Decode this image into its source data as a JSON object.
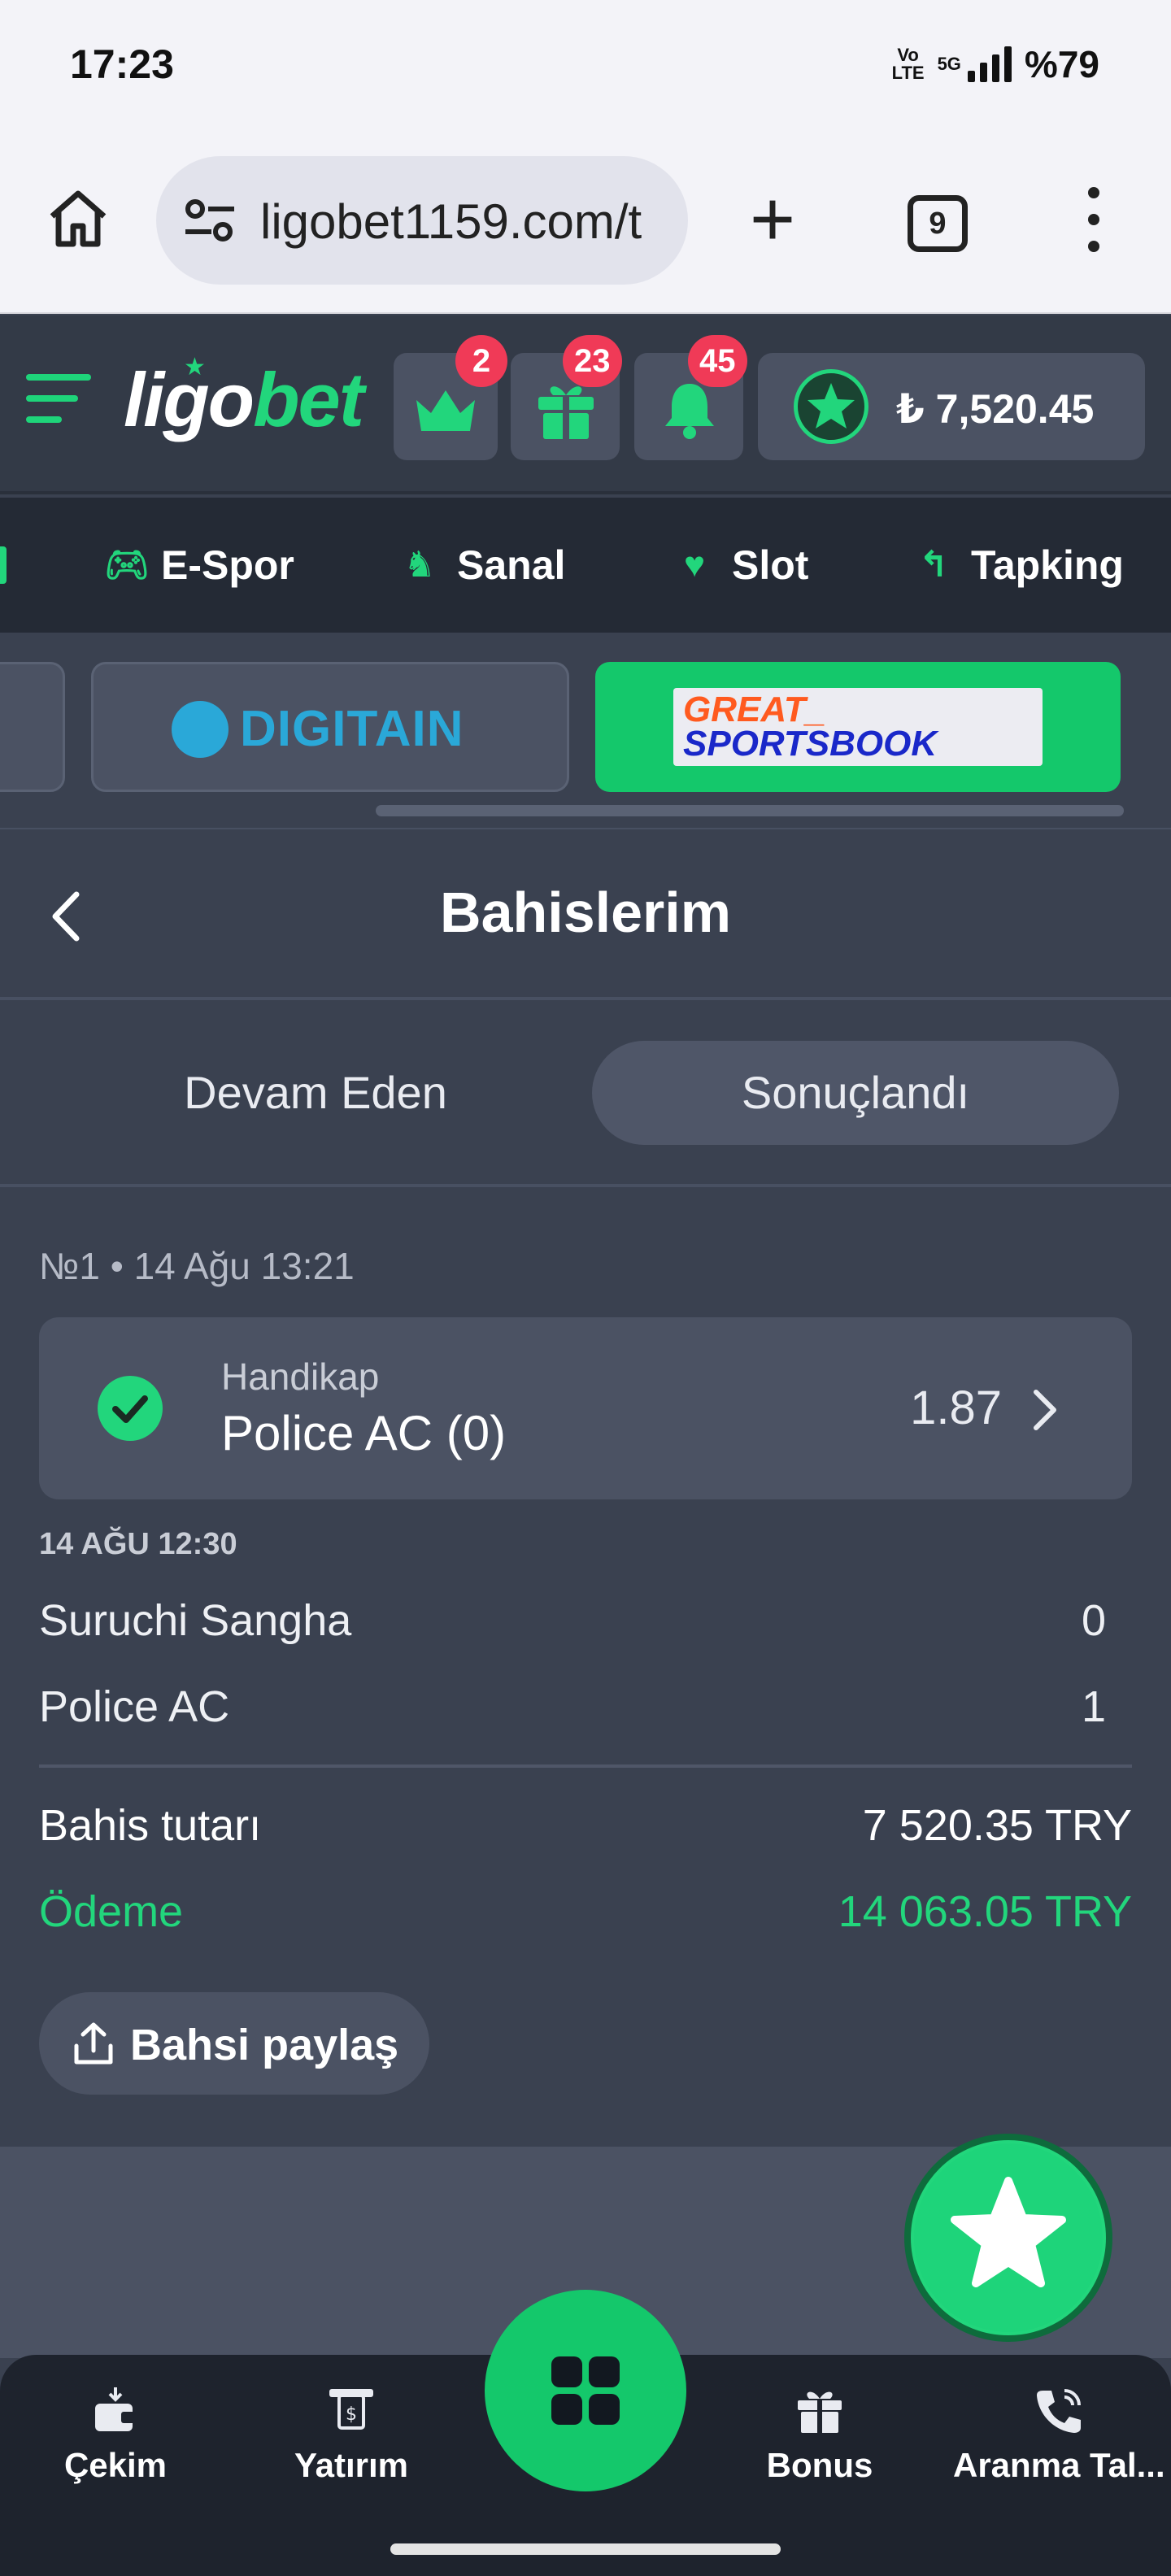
{
  "status_bar": {
    "time": "17:23",
    "network": "Vo\nLTE",
    "network_5g": "5G",
    "battery": "%79"
  },
  "browser": {
    "url": "ligobet1159.com/t",
    "tab_count": "9"
  },
  "header": {
    "logo_part1": "ligo",
    "logo_part2": "bet",
    "vip_badge": "2",
    "gift_badge": "23",
    "bell_badge": "45",
    "balance": "₺ 7,520.45"
  },
  "categories": [
    {
      "label": "E-Spor",
      "icon": "gamepad-icon"
    },
    {
      "label": "Sanal",
      "icon": "horse-icon"
    },
    {
      "label": "Slot",
      "icon": "strawberry-icon"
    },
    {
      "label": "Tapking",
      "icon": "tapking-icon"
    }
  ],
  "providers": {
    "digitain": "DIGITAIN",
    "gsb_line1": "GREAT_",
    "gsb_line2": "SPORTSBOOK"
  },
  "page": {
    "title": "Bahislerim",
    "tab_active": "Devam Eden",
    "tab_settled": "Sonuçlandı"
  },
  "bet": {
    "meta": "№1 • 14 Ağu 13:21",
    "market": "Handikap",
    "pick": "Police AC (0)",
    "odds": "1.87",
    "match_date": "14 AĞU 12:30",
    "home_team": "Suruchi Sangha",
    "home_score": "0",
    "away_team": "Police AC",
    "away_score": "1",
    "stake_label": "Bahis tutarı",
    "stake_value": "7 520.35 TRY",
    "payout_label": "Ödeme",
    "payout_value": "14 063.05 TRY",
    "share_label": "Bahsi paylaş"
  },
  "bottom_nav": {
    "withdraw": "Çekim",
    "deposit": "Yatırım",
    "bonus": "Bonus",
    "call": "Aranma Tal..."
  },
  "colors": {
    "accent": "#22d67c",
    "badge": "#f03a57",
    "background": "#3a4150"
  }
}
